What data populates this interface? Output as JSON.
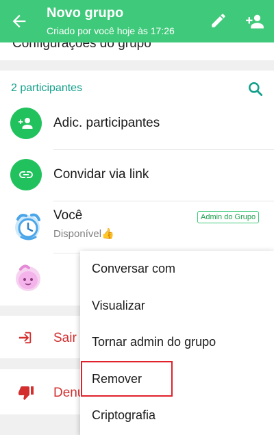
{
  "app_bar": {
    "title": "Novo grupo",
    "subtitle": "Criado por você hoje às 17:26",
    "color": "#3fc97a"
  },
  "peek_row": {
    "label": "Configurações do grupo"
  },
  "participants": {
    "section_title": "2 participantes",
    "actions": [
      {
        "label": "Adic. participantes",
        "icon": "person-add-icon"
      },
      {
        "label": "Convidar via link",
        "icon": "link-icon"
      }
    ],
    "members": [
      {
        "name": "Você",
        "status": "Disponível👍",
        "badge": "Admin do Grupo"
      },
      {
        "name": "",
        "status": ""
      }
    ]
  },
  "actions": {
    "exit_label": "Sair",
    "report_label": "Denu"
  },
  "context_menu": {
    "items": [
      "Conversar com",
      "Visualizar",
      "Tornar admin do grupo",
      "Remover",
      "Criptografia"
    ],
    "highlighted": "Remover"
  }
}
